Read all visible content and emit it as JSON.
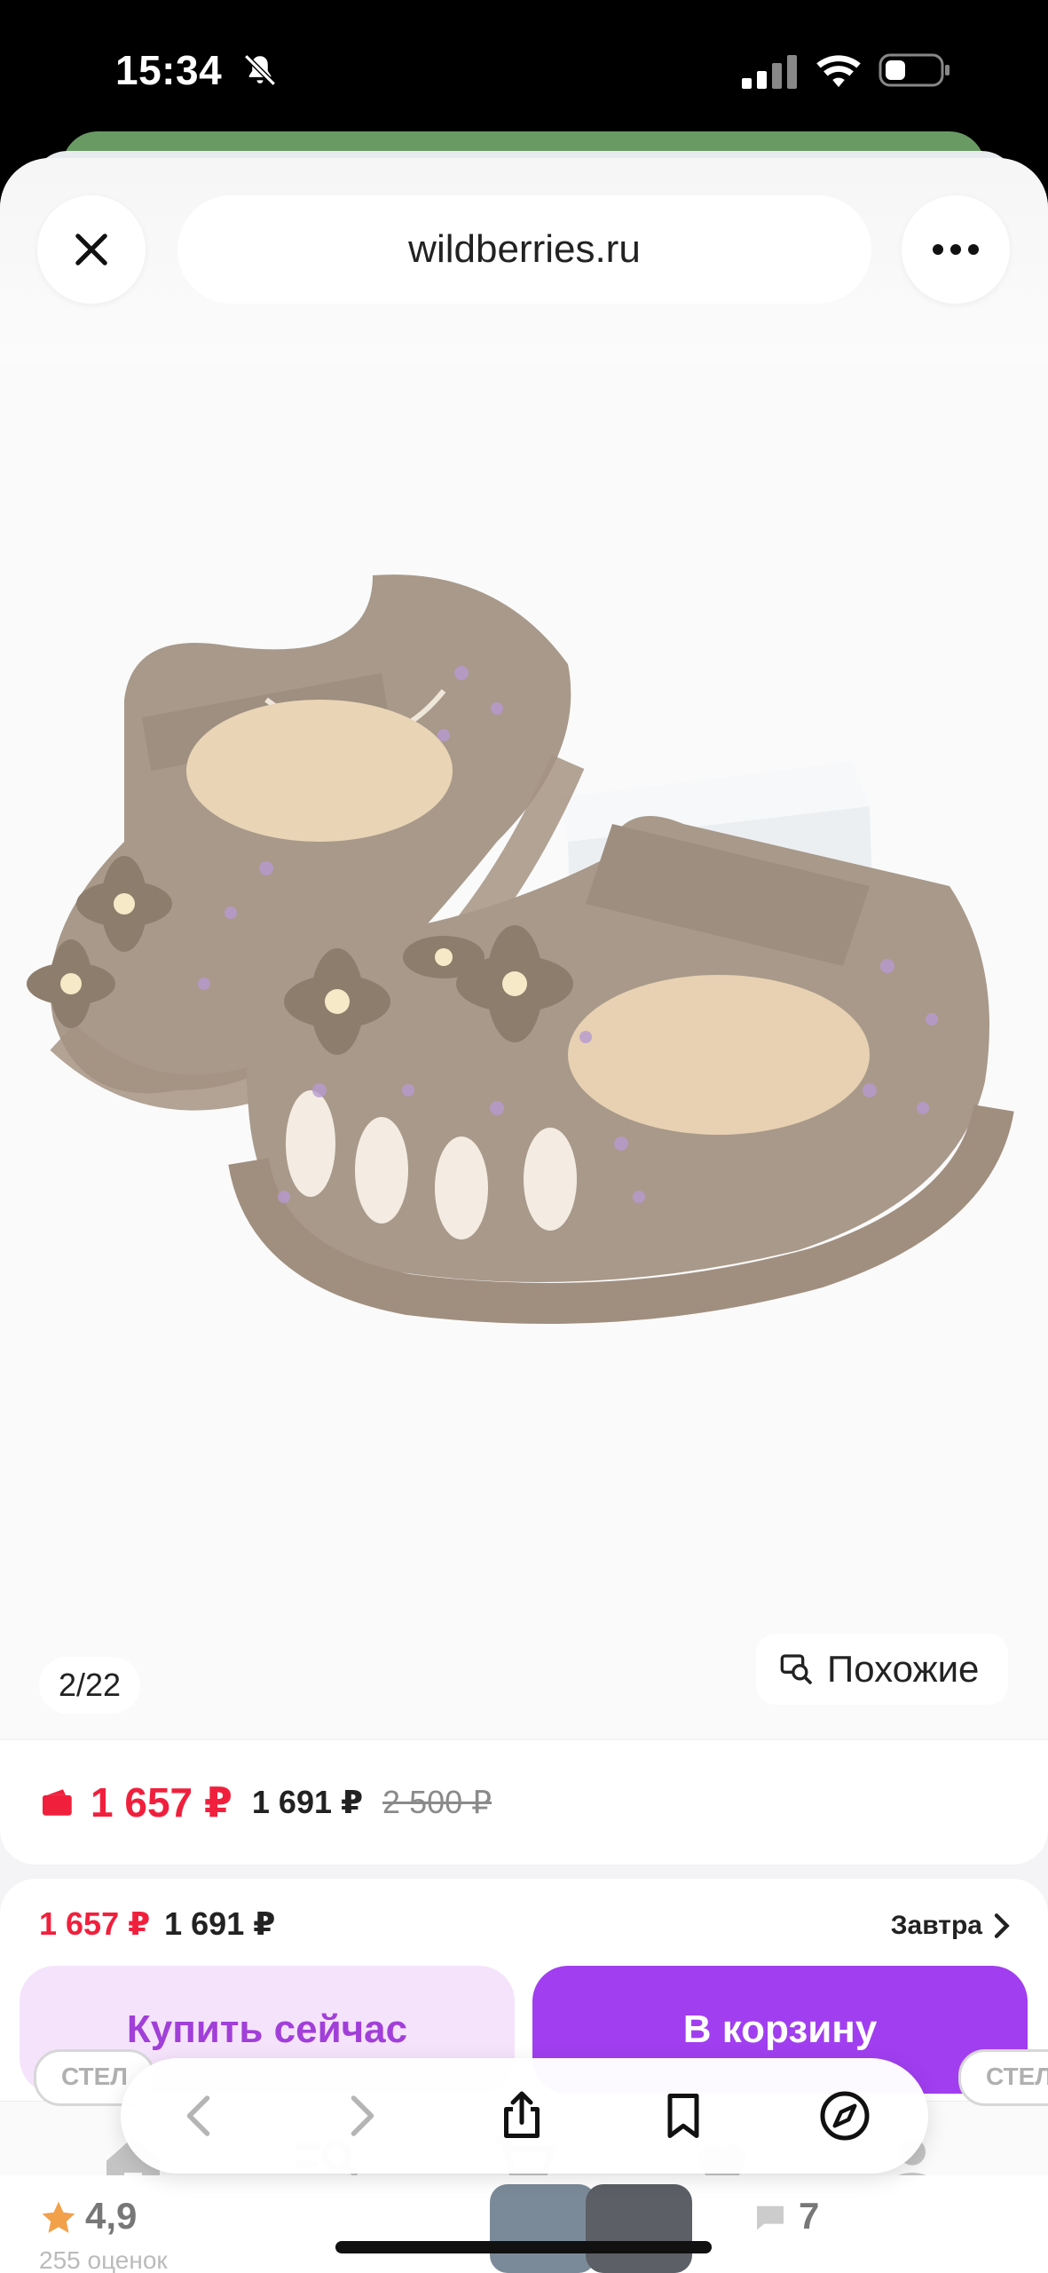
{
  "status_bar": {
    "time": "15:34"
  },
  "browser": {
    "url": "wildberries.ru"
  },
  "gallery": {
    "counter": "2/22",
    "similar_label": "Похожие"
  },
  "price": {
    "main": "1 657 ₽",
    "second": "1 691 ₽",
    "old": "2 500 ₽"
  },
  "buy_panel": {
    "price_red": "1 657 ₽",
    "price_dark": "1 691 ₽",
    "delivery": "Завтра",
    "buy_now": "Купить сейчас",
    "add_to_cart": "В корзину"
  },
  "chips": {
    "left": "СТЕЛ",
    "right": "СТЕЛ"
  },
  "bottom": {
    "rating": "4,9",
    "reviews": "255 оценок",
    "count": "7"
  },
  "colors": {
    "accent": "#a13ef0",
    "price_red": "#f0203d"
  }
}
